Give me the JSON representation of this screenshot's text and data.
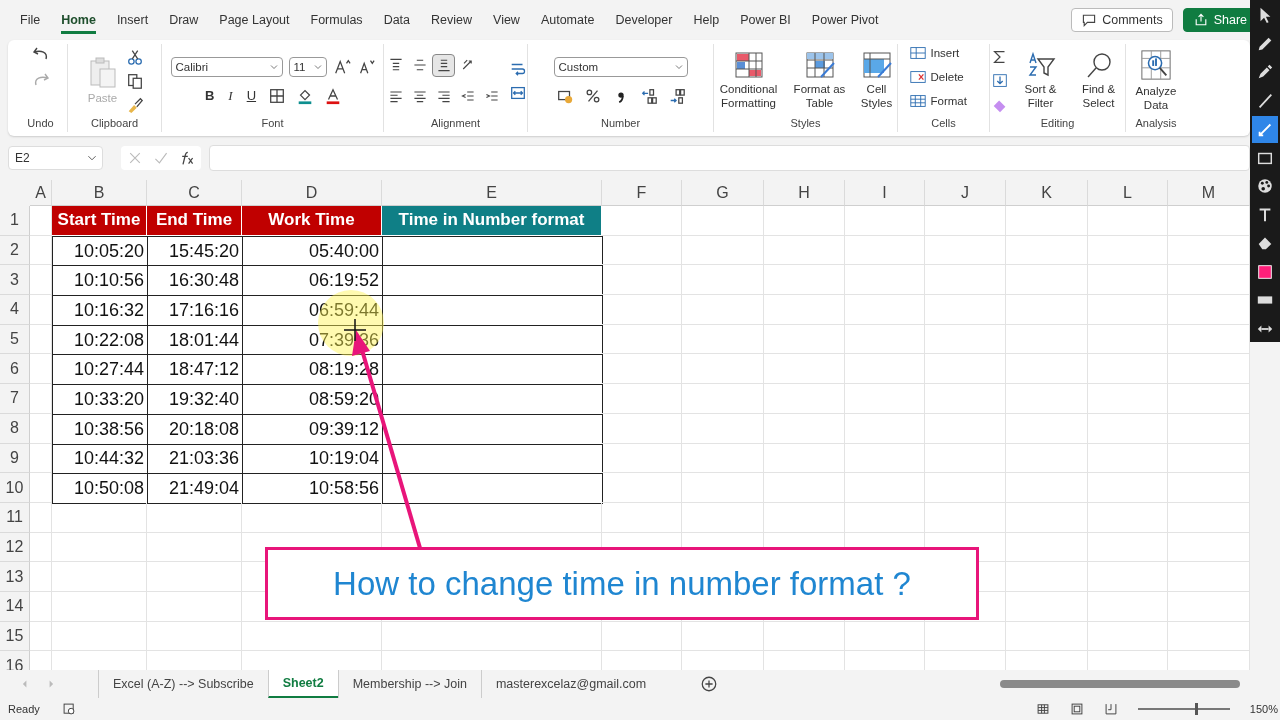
{
  "menu_tabs": [
    {
      "label": "File",
      "selected": false
    },
    {
      "label": "Home",
      "selected": true
    },
    {
      "label": "Insert",
      "selected": false
    },
    {
      "label": "Draw",
      "selected": false
    },
    {
      "label": "Page Layout",
      "selected": false
    },
    {
      "label": "Formulas",
      "selected": false
    },
    {
      "label": "Data",
      "selected": false
    },
    {
      "label": "Review",
      "selected": false
    },
    {
      "label": "View",
      "selected": false
    },
    {
      "label": "Automate",
      "selected": false
    },
    {
      "label": "Developer",
      "selected": false
    },
    {
      "label": "Help",
      "selected": false
    },
    {
      "label": "Power BI",
      "selected": false
    },
    {
      "label": "Power Pivot",
      "selected": false
    }
  ],
  "comments_button": "Comments",
  "share_button": "Share",
  "ribbon": {
    "undo": {
      "label": "Undo"
    },
    "clipboard": {
      "label": "Clipboard",
      "paste": "Paste"
    },
    "font": {
      "label": "Font",
      "font_name": "Calibri",
      "font_size": "11",
      "styles": [
        "B",
        "I",
        "U"
      ]
    },
    "alignment": {
      "label": "Alignment",
      "buttons": [
        {
          "kind": "align-top",
          "selected": false
        },
        {
          "kind": "align-middle",
          "selected": false
        },
        {
          "kind": "align-bottom",
          "selected": true
        },
        {
          "kind": "orientation",
          "selected": false
        },
        {
          "kind": "align-left",
          "selected": false
        },
        {
          "kind": "align-center",
          "selected": false
        },
        {
          "kind": "align-right",
          "selected": false
        },
        {
          "kind": "outdent",
          "selected": false
        },
        {
          "kind": "indent",
          "selected": false
        }
      ]
    },
    "number": {
      "label": "Number",
      "format": "Custom"
    },
    "styles": {
      "label": "Styles",
      "buttons": [
        {
          "kind": "conditional",
          "label": "Conditional Formatting"
        },
        {
          "kind": "table",
          "label": "Format as Table"
        },
        {
          "kind": "cell-styles",
          "label": "Cell Styles"
        }
      ]
    },
    "cells": {
      "label": "Cells",
      "buttons": [
        {
          "kind": "insert",
          "label": "Insert"
        },
        {
          "kind": "delete",
          "label": "Delete"
        },
        {
          "kind": "format",
          "label": "Format"
        }
      ]
    },
    "editing": {
      "label": "Editing",
      "buttons": [
        {
          "kind": "sort",
          "label": "Sort & Filter"
        },
        {
          "kind": "find",
          "label": "Find & Select"
        }
      ]
    },
    "analysis": {
      "label": "Analysis",
      "button": "Analyze Data"
    }
  },
  "formula_bar": {
    "name_box": "E2"
  },
  "sheet": {
    "columns": [
      "A",
      "B",
      "C",
      "D",
      "E",
      "F",
      "G",
      "H",
      "I",
      "J",
      "K",
      "L",
      "M"
    ],
    "rows": [
      "1",
      "2",
      "3",
      "4",
      "5",
      "6",
      "7",
      "8",
      "9",
      "10",
      "11",
      "12",
      "13",
      "14",
      "15",
      "16"
    ],
    "table": {
      "headers": [
        {
          "label": "Start Time",
          "color": "#c00000"
        },
        {
          "label": "End Time",
          "color": "#c00000"
        },
        {
          "label": "Work Time",
          "color": "#c00000"
        },
        {
          "label": "Time in Number format",
          "color": "#0f7f86"
        }
      ],
      "rows": [
        [
          "10:05:20",
          "15:45:20",
          "05:40:00"
        ],
        [
          "10:10:56",
          "16:30:48",
          "06:19:52"
        ],
        [
          "10:16:32",
          "17:16:16",
          "06:59:44"
        ],
        [
          "10:22:08",
          "18:01:44",
          "07:39:36"
        ],
        [
          "10:27:44",
          "18:47:12",
          "08:19:28"
        ],
        [
          "10:33:20",
          "19:32:40",
          "08:59:20"
        ],
        [
          "10:38:56",
          "20:18:08",
          "09:39:12"
        ],
        [
          "10:44:32",
          "21:03:36",
          "10:19:04"
        ],
        [
          "10:50:08",
          "21:49:04",
          "10:58:56"
        ]
      ]
    }
  },
  "callout": {
    "text": "How to change time in number format ?"
  },
  "sheet_tabs": [
    {
      "label": "Excel (A-Z) --> Subscribe",
      "selected": false
    },
    {
      "label": "Sheet2",
      "selected": true
    },
    {
      "label": "Membership --> Join",
      "selected": false
    },
    {
      "label": "masterexcelaz@gmail.com",
      "selected": false
    }
  ],
  "status_bar": {
    "status": "Ready",
    "zoom_slider": {
      "level": 0.63
    },
    "zoom": "150%"
  },
  "annotation_toolbar": [
    {
      "kind": "pointer",
      "selected": false
    },
    {
      "kind": "pencil",
      "selected": false
    },
    {
      "kind": "marker",
      "selected": false
    },
    {
      "kind": "line",
      "selected": false
    },
    {
      "kind": "arrow",
      "selected": true
    },
    {
      "kind": "rectangle",
      "selected": false
    },
    {
      "kind": "palette",
      "selected": false
    },
    {
      "kind": "text-tool",
      "selected": false
    },
    {
      "kind": "eraser",
      "selected": false
    },
    {
      "kind": "color-swatch",
      "selected": false
    },
    {
      "kind": "thickness",
      "selected": false
    },
    {
      "kind": "resize",
      "selected": false
    }
  ]
}
